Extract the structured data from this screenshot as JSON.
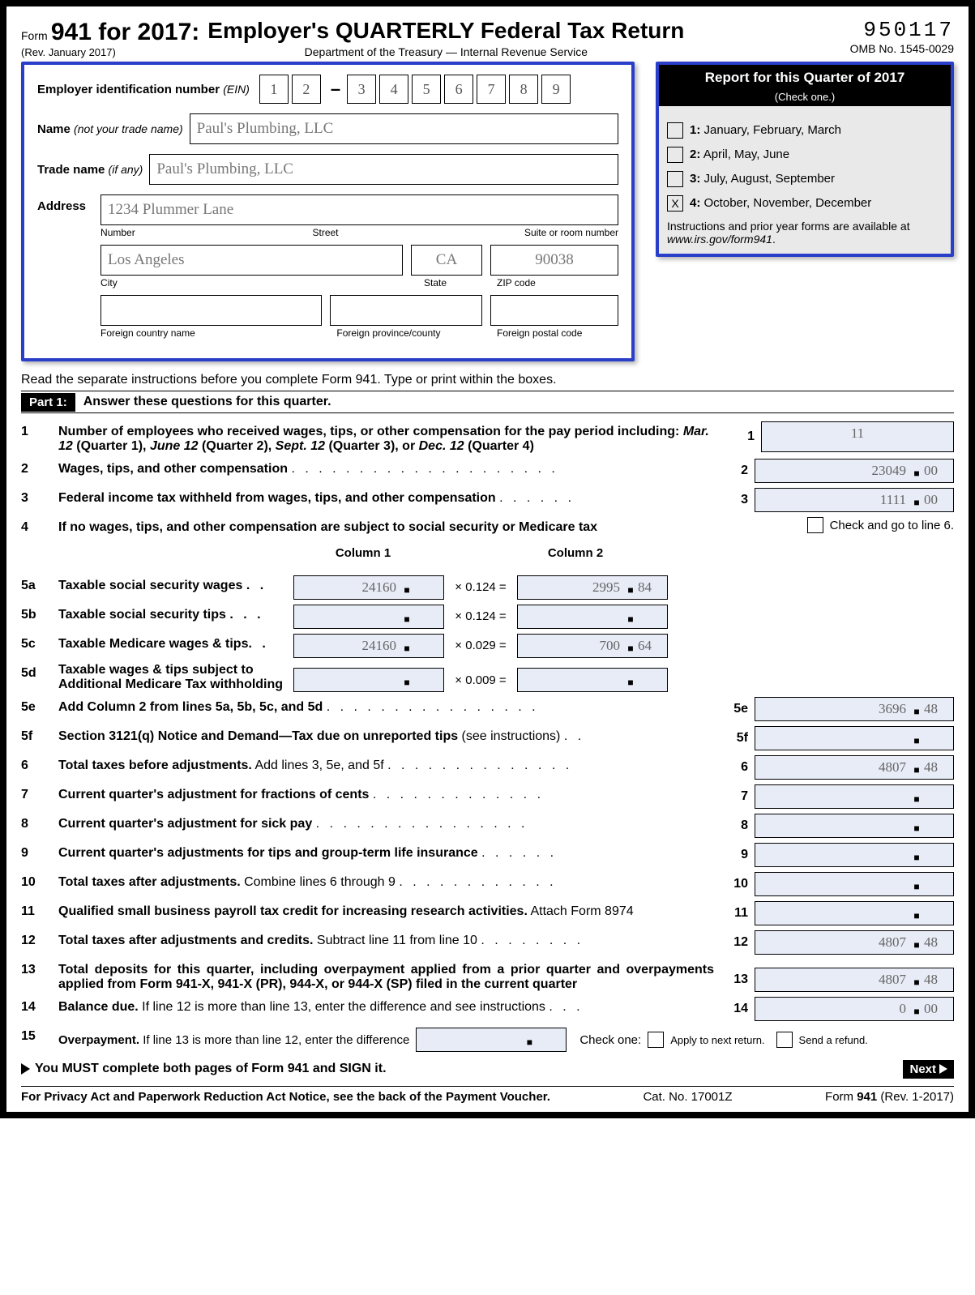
{
  "header": {
    "form_word": "Form",
    "form_num": "941 for 2017:",
    "rev": "(Rev. January 2017)",
    "title": "Employer's QUARTERLY Federal Tax Return",
    "dept": "Department of the Treasury — Internal Revenue Service",
    "code": "950117",
    "omb": "OMB No. 1545-0029"
  },
  "emp": {
    "ein_label": "Employer identification number",
    "ein_abbr": "(EIN)",
    "ein": [
      "1",
      "2",
      "3",
      "4",
      "5",
      "6",
      "7",
      "8",
      "9"
    ],
    "name_label": "Name",
    "name_sub": "(not your trade name)",
    "name": "Paul's Plumbing, LLC",
    "trade_label": "Trade name",
    "trade_sub": "(if any)",
    "trade": "Paul's Plumbing, LLC",
    "addr_label": "Address",
    "street": "1234 Plummer Lane",
    "street_sub_num": "Number",
    "street_sub_st": "Street",
    "street_sub_suite": "Suite or room number",
    "city": "Los Angeles",
    "state": "CA",
    "zip": "90038",
    "city_sub": "City",
    "state_sub": "State",
    "zip_sub": "ZIP code",
    "fc": "",
    "fp": "",
    "fz": "",
    "fc_sub": "Foreign country name",
    "fp_sub": "Foreign province/county",
    "fz_sub": "Foreign postal code"
  },
  "quarter": {
    "title": "Report for this Quarter of 2017",
    "sub": "(Check one.)",
    "opts": [
      {
        "n": "1:",
        "t": "January, February, March",
        "x": ""
      },
      {
        "n": "2:",
        "t": "April, May, June",
        "x": ""
      },
      {
        "n": "3:",
        "t": "July, August, September",
        "x": ""
      },
      {
        "n": "4:",
        "t": "October, November, December",
        "x": "X"
      }
    ],
    "note1": "Instructions and prior year forms are available at ",
    "note_url": "www.irs.gov/form941",
    "note2": "."
  },
  "pre_instr": "Read the separate instructions before you complete Form 941. Type or print within the boxes.",
  "part1": {
    "tag": "Part 1:",
    "title": "Answer these questions for this quarter."
  },
  "l1": {
    "n": "1",
    "txt1": "Number of employees who received wages, tips, or other compensation for the pay period including: ",
    "txt2": "Mar. 12",
    "txt3": " (Quarter 1), ",
    "txt4": "June 12",
    "txt5": " (Quarter 2), ",
    "txt6": "Sept. 12",
    "txt7": " (Quarter 3), or ",
    "txt8": "Dec. 12",
    "txt9": " (Quarter 4)",
    "rn": "1",
    "val": "11"
  },
  "l2": {
    "n": "2",
    "t": "Wages, tips, and other compensation",
    "rn": "2",
    "d": "23049",
    "c": "00"
  },
  "l3": {
    "n": "3",
    "t": "Federal income tax withheld from wages, tips, and other compensation",
    "rn": "3",
    "d": "1111",
    "c": "00"
  },
  "l4": {
    "n": "4",
    "t": "If no wages, tips, and other compensation are subject to social security or Medicare tax",
    "chk": "Check and go to line 6."
  },
  "cols": {
    "c1": "Column 1",
    "c2": "Column 2"
  },
  "l5a": {
    "n": "5a",
    "t": "Taxable social security wages",
    "m": "× 0.124 =",
    "d1": "24160",
    "c1": "",
    "d2": "2995",
    "c2": "84"
  },
  "l5b": {
    "n": "5b",
    "t": "Taxable social security tips",
    "m": "× 0.124 =",
    "d1": "",
    "c1": "",
    "d2": "",
    "c2": ""
  },
  "l5c": {
    "n": "5c",
    "t": "Taxable Medicare wages & tips",
    "m": "× 0.029 =",
    "d1": "24160",
    "c1": "",
    "d2": "700",
    "c2": "64"
  },
  "l5d": {
    "n": "5d",
    "t1": "Taxable wages & tips subject to",
    "t2": "Additional Medicare Tax withholding",
    "m": "× 0.009 =",
    "d1": "",
    "c1": "",
    "d2": "",
    "c2": ""
  },
  "l5e": {
    "n": "5e",
    "t": "Add Column 2 from lines 5a, 5b, 5c, and 5d",
    "rn": "5e",
    "d": "3696",
    "c": "48"
  },
  "l5f": {
    "n": "5f",
    "t1": "Section 3121(q) Notice and Demand—Tax due on unreported tips",
    "t2": " (see instructions)",
    "rn": "5f",
    "d": "",
    "c": ""
  },
  "l6": {
    "n": "6",
    "t1": "Total taxes before adjustments.",
    "t2": " Add lines 3, 5e, and 5f",
    "rn": "6",
    "d": "4807",
    "c": "48"
  },
  "l7": {
    "n": "7",
    "t": "Current quarter's adjustment for fractions of cents",
    "rn": "7",
    "d": "",
    "c": ""
  },
  "l8": {
    "n": "8",
    "t": "Current quarter's adjustment for sick pay",
    "rn": "8",
    "d": "",
    "c": ""
  },
  "l9": {
    "n": "9",
    "t": "Current quarter's adjustments for tips and group-term life insurance",
    "rn": "9",
    "d": "",
    "c": ""
  },
  "l10": {
    "n": "10",
    "t1": "Total taxes after adjustments.",
    "t2": " Combine lines 6 through 9",
    "rn": "10",
    "d": "",
    "c": ""
  },
  "l11": {
    "n": "11",
    "t1": "Qualified small business payroll tax credit for increasing research activities.",
    "t2": " Attach Form 8974",
    "rn": "11",
    "d": "",
    "c": ""
  },
  "l12": {
    "n": "12",
    "t1": "Total taxes after adjustments and credits.",
    "t2": " Subtract line 11 from line 10",
    "rn": "12",
    "d": "4807",
    "c": "48"
  },
  "l13": {
    "n": "13",
    "t1": "Total deposits for this quarter, including overpayment applied from a prior quarter and overpayments applied from Form 941-X, 941-X (PR), 944-X, or 944-X (SP) filed in the current quarter",
    "rn": "13",
    "d": "4807",
    "c": "48"
  },
  "l14": {
    "n": "14",
    "t1": "Balance due.",
    "t2": " If line 12 is more than line 13, enter the difference and see instructions",
    "rn": "14",
    "d": "0",
    "c": "00"
  },
  "l15": {
    "n": "15",
    "t1": "Overpayment.",
    "t2": " If line 13 is more than line 12, enter the difference",
    "check": "Check one:",
    "o1": "Apply to next return.",
    "o2": "Send a refund."
  },
  "must": "You MUST complete both pages of Form 941 and SIGN it.",
  "next": "Next",
  "footer": {
    "l": "For Privacy Act and Paperwork Reduction Act Notice, see the back of the Payment Voucher.",
    "m": "Cat. No. 17001Z",
    "r1": "Form ",
    "r2": "941",
    "r3": " (Rev. 1-2017)"
  }
}
